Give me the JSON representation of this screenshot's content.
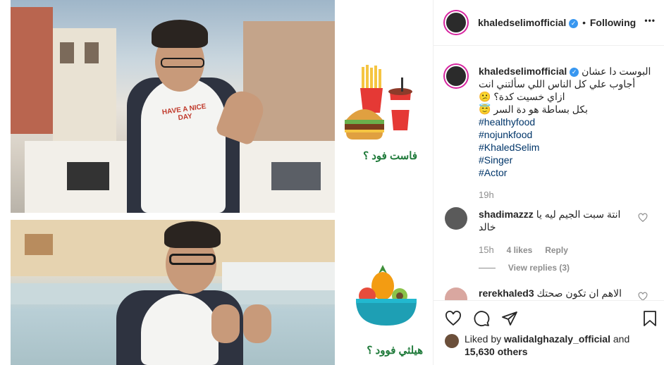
{
  "media": {
    "fast_food_label": "فاست فود ؟",
    "healthy_food_label": "هيلثي فوود ؟",
    "tshirt_text": "HAVE A NICE DAY"
  },
  "header": {
    "username": "khaledselimofficial",
    "verified_glyph": "✓",
    "separator": "•",
    "follow_state": "Following",
    "more_glyph": "•••"
  },
  "caption": {
    "username": "khaledselimofficial",
    "line1": "البوست دا عشان",
    "line2": "أجاوب علي كل الناس اللي سألتني انت",
    "line3": "ازاي خسيت كدة؟ 😕",
    "line4": "بكل بساطة هو دة السر 😇",
    "hashtags": [
      "#healthyfood",
      "#nojunkfood",
      "#KhaledSelim",
      "#Singer",
      "#Actor"
    ],
    "time": "19h"
  },
  "comments": [
    {
      "username": "shadimazzz",
      "text_line1": "انتة سبت الجيم ليه يا",
      "text_line2": "خالد",
      "time": "15h",
      "likes": "4 likes",
      "reply_label": "Reply",
      "view_replies": "View replies (3)"
    },
    {
      "username": "rerekhaled3",
      "text_line1": "الاهم ان تكون صحتك"
    }
  ],
  "likes": {
    "prefix": "Liked by",
    "user": "walidalghazaly_official",
    "conj": "and",
    "others": "15,630 others"
  },
  "icons": {
    "like": "heart-icon",
    "comment": "comment-icon",
    "share": "share-icon",
    "save": "bookmark-icon"
  },
  "colors": {
    "verified": "#3897f0",
    "hashtag": "#003569",
    "muted": "#8e8e8e",
    "story_ring": "#d6249f",
    "arabic_caption": "#1f7a3a"
  }
}
